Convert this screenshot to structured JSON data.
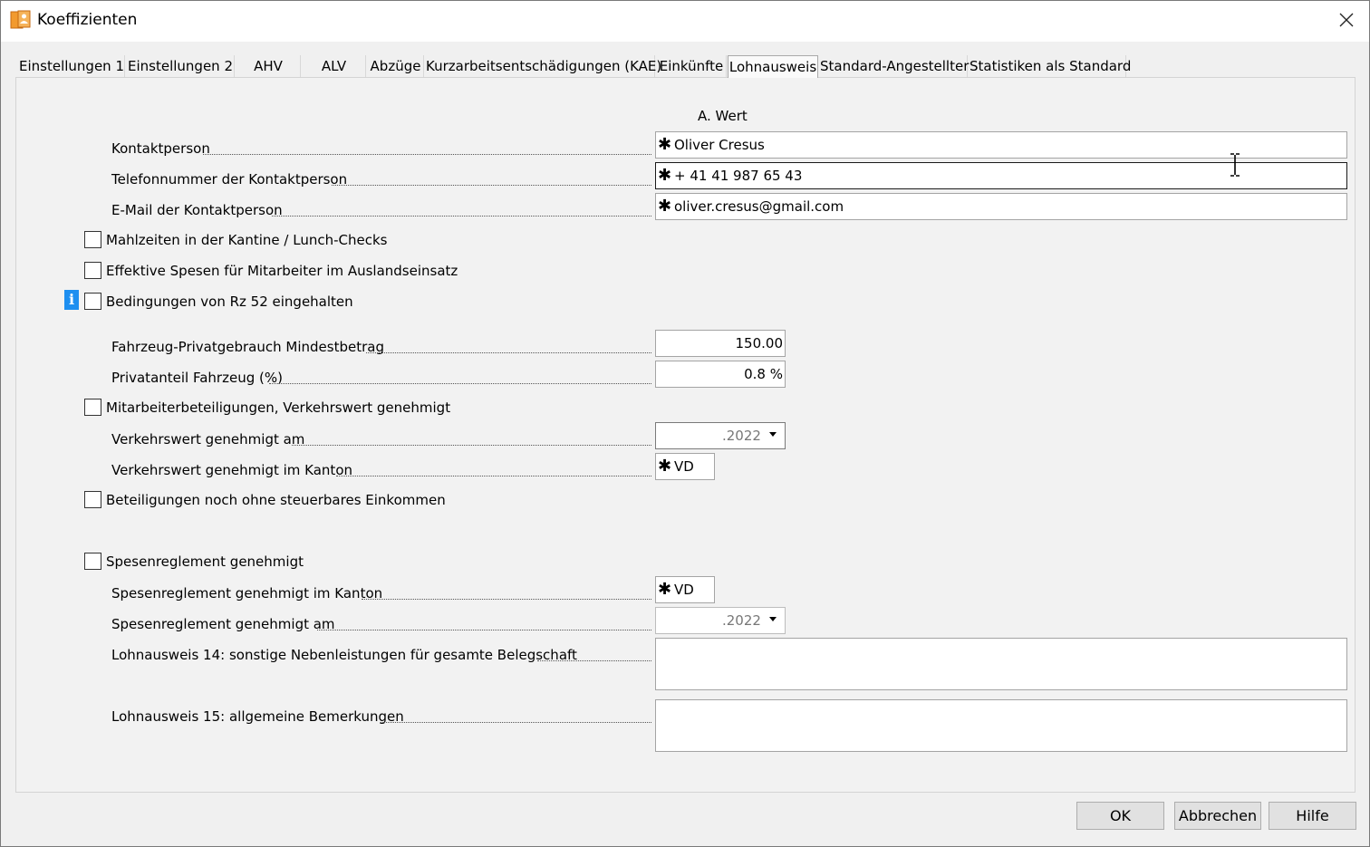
{
  "window": {
    "title": "Koeffizienten"
  },
  "tabs": [
    {
      "label": "Einstellungen 1"
    },
    {
      "label": "Einstellungen 2"
    },
    {
      "label": "AHV"
    },
    {
      "label": "ALV"
    },
    {
      "label": "Abzüge"
    },
    {
      "label": "Kurzarbeitsentschädigungen (KAE)"
    },
    {
      "label": "Einkünfte"
    },
    {
      "label": "Lohnausweis",
      "active": true
    },
    {
      "label": "Standard-Angestellter"
    },
    {
      "label": "Statistiken als Standard"
    }
  ],
  "column_header": "A. Wert",
  "required_marker": "✱",
  "contact": {
    "person_label": "Kontaktperson",
    "person_value": "Oliver Cresus",
    "phone_label": "Telefonnummer der Kontaktperson",
    "phone_value": "+ 41 41 987 65 43",
    "email_label": "E-Mail der Kontaktperson",
    "email_value": "oliver.cresus@gmail.com"
  },
  "checkboxes": {
    "meals": {
      "label": "Mahlzeiten in der Kantine / Lunch-Checks",
      "checked": false
    },
    "expenses_abroad": {
      "label": "Effektive Spesen für Mitarbeiter im Auslandseinsatz",
      "checked": false
    },
    "rz52": {
      "label": "Bedingungen von Rz 52 eingehalten",
      "checked": false
    },
    "participations": {
      "label": "Mitarbeiterbeteiligungen, Verkehrswert genehmigt",
      "checked": false
    },
    "participations_no_income": {
      "label": "Beteiligungen noch ohne steuerbares Einkommen",
      "checked": false
    },
    "expense_rules": {
      "label": "Spesenreglement genehmigt",
      "checked": false
    }
  },
  "vehicle": {
    "min_amount_label": "Fahrzeug-Privatgebrauch Mindestbetrag",
    "min_amount_value": "150.00",
    "private_share_label": "Privatanteil Fahrzeug (%)",
    "private_share_value": "0.8 %"
  },
  "market_value": {
    "date_label": "Verkehrswert genehmigt am",
    "date_value": ".2022",
    "canton_label": "Verkehrswert genehmigt im Kanton",
    "canton_value": "VD"
  },
  "expense_rules": {
    "canton_label": "Spesenreglement genehmigt im Kanton",
    "canton_value": "VD",
    "date_label": "Spesenreglement genehmigt am",
    "date_value": ".2022"
  },
  "remarks": {
    "field14_label": "Lohnausweis 14: sonstige Nebenleistungen für gesamte Belegschaft",
    "field14_value": "",
    "field15_label": "Lohnausweis 15: allgemeine Bemerkungen",
    "field15_value": ""
  },
  "buttons": {
    "ok": "OK",
    "cancel": "Abbrechen",
    "help": "Hilfe"
  },
  "icons": {
    "app": "app-icon",
    "close": "close-icon",
    "info": "info-icon",
    "cursor": "text-cursor-icon"
  }
}
